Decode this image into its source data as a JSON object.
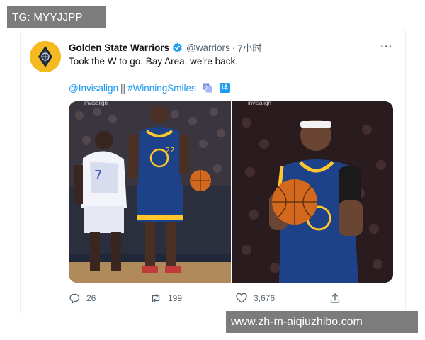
{
  "watermarks": {
    "top": "TG: MYYJJPP",
    "bottom": "www.zh-m-aiqiuzhibo.com"
  },
  "tweet": {
    "author": {
      "display_name": "Golden State Warriors",
      "handle": "@warriors",
      "time": "7小时",
      "avatar_icon": "warriors-logo-icon",
      "verified_icon": "verified-badge-icon"
    },
    "text": "Took the W to go. Bay Area, we're back.",
    "mention": "@Invisalign",
    "separator": "||",
    "hashtag": "#WinningSmiles",
    "translate_icon": "translate-icon",
    "translate_badge": "译",
    "media": [
      {
        "caption": "invisalign",
        "description_icon": "basketball-photo-1"
      },
      {
        "caption": "invisalign",
        "description_icon": "basketball-photo-2"
      }
    ],
    "actions": {
      "reply_count": "26",
      "retweet_count": "199",
      "like_count": "3,676"
    },
    "more_icon": "more-options-icon"
  },
  "colors": {
    "link": "#1d9bf0",
    "muted": "#536471",
    "text": "#0f1419",
    "avatar_bg": "#f5b921",
    "jersey_blue": "#1d428a",
    "jersey_gold": "#ffc72c"
  }
}
